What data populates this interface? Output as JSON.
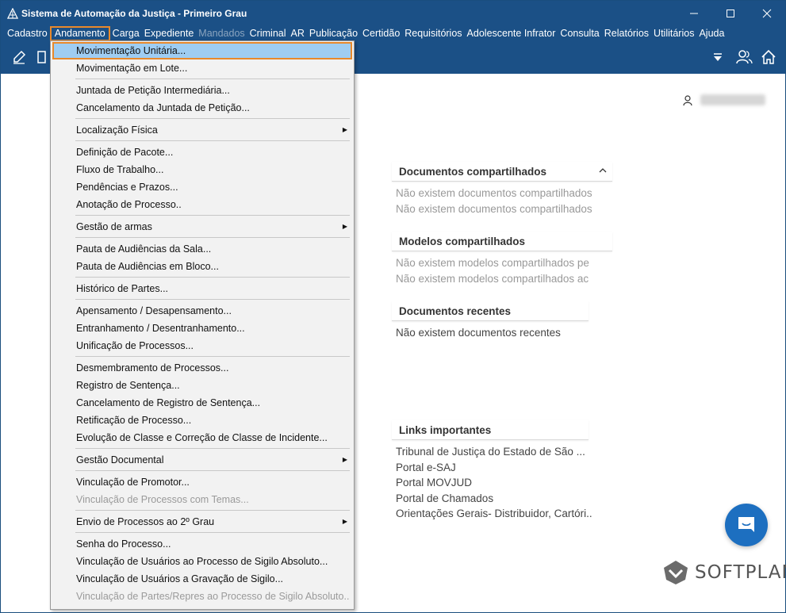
{
  "window": {
    "title": "Sistema de Automação da Justiça - Primeiro Grau"
  },
  "menubar": {
    "items": [
      {
        "label": "Cadastro",
        "state": "normal"
      },
      {
        "label": "Andamento",
        "state": "active"
      },
      {
        "label": "Carga",
        "state": "normal"
      },
      {
        "label": "Expediente",
        "state": "normal"
      },
      {
        "label": "Mandados",
        "state": "disabled"
      },
      {
        "label": "Criminal",
        "state": "normal"
      },
      {
        "label": "AR",
        "state": "normal"
      },
      {
        "label": "Publicação",
        "state": "normal"
      },
      {
        "label": "Certidão",
        "state": "normal"
      },
      {
        "label": "Requisitórios",
        "state": "normal"
      },
      {
        "label": "Adolescente Infrator",
        "state": "normal"
      },
      {
        "label": "Consulta",
        "state": "normal"
      },
      {
        "label": "Relatórios",
        "state": "normal"
      },
      {
        "label": "Utilitários",
        "state": "normal"
      },
      {
        "label": "Ajuda",
        "state": "normal"
      }
    ]
  },
  "dropdown": {
    "items": [
      {
        "label": "Movimentação Unitária...",
        "state": "highlight"
      },
      {
        "label": "Movimentação em Lote...",
        "state": "normal"
      },
      {
        "label": "Juntada de Petição Intermediária...",
        "state": "normal"
      },
      {
        "label": "Cancelamento da Juntada de Petição...",
        "state": "normal"
      },
      {
        "label": "Localização Física",
        "state": "normal",
        "submenu": true
      },
      {
        "label": "Definição de Pacote...",
        "state": "normal"
      },
      {
        "label": "Fluxo de Trabalho...",
        "state": "normal"
      },
      {
        "label": "Pendências e Prazos...",
        "state": "normal"
      },
      {
        "label": "Anotação de Processo..",
        "state": "normal"
      },
      {
        "label": "Gestão de armas",
        "state": "normal",
        "submenu": true
      },
      {
        "label": "Pauta de Audiências da Sala...",
        "state": "normal"
      },
      {
        "label": "Pauta de Audiências em Bloco...",
        "state": "normal"
      },
      {
        "label": "Histórico de Partes...",
        "state": "normal"
      },
      {
        "label": "Apensamento / Desapensamento...",
        "state": "normal"
      },
      {
        "label": "Entranhamento / Desentranhamento...",
        "state": "normal"
      },
      {
        "label": "Unificação de Processos...",
        "state": "normal"
      },
      {
        "label": "Desmembramento de Processos...",
        "state": "normal"
      },
      {
        "label": "Registro de Sentença...",
        "state": "normal"
      },
      {
        "label": "Cancelamento de Registro de Sentença...",
        "state": "normal"
      },
      {
        "label": "Retificação de Processo...",
        "state": "normal"
      },
      {
        "label": "Evolução de Classe e Correção de Classe de Incidente...",
        "state": "normal"
      },
      {
        "label": "Gestão Documental",
        "state": "normal",
        "submenu": true
      },
      {
        "label": "Vinculação de Promotor...",
        "state": "normal"
      },
      {
        "label": "Vinculação de Processos com Temas...",
        "state": "disabled"
      },
      {
        "label": "Envio de Processos ao 2º Grau",
        "state": "normal",
        "submenu": true
      },
      {
        "label": "Senha do Processo...",
        "state": "normal"
      },
      {
        "label": "Vinculação de Usuários ao Processo de Sigilo Absoluto...",
        "state": "normal"
      },
      {
        "label": "Vinculação de Usuários a Gravação de Sigilo...",
        "state": "normal"
      },
      {
        "label": "Vinculação de Partes/Repres ao Processo de Sigilo Absoluto..",
        "state": "disabled"
      }
    ]
  },
  "panels": {
    "shared_docs": {
      "title": "Documentos compartilhados",
      "lines": [
        "Não existem documentos compartilhados ...",
        "Não existem documentos compartilhados ..."
      ]
    },
    "shared_models": {
      "title": "Modelos compartilhados",
      "lines": [
        "Não existem modelos compartilhados pe",
        "Não existem modelos compartilhados ac"
      ]
    },
    "recent_docs": {
      "title": "Documentos recentes",
      "lines": [
        "Não existem documentos recentes"
      ]
    },
    "links": {
      "title": "Links importantes",
      "lines": [
        "Tribunal de Justiça do Estado de São ...",
        "Portal e-SAJ",
        "Portal MOVJUD",
        "Portal de Chamados",
        "Orientações Gerais- Distribuidor, Cartóri.."
      ]
    }
  },
  "brand": {
    "name": "SOFTPLAN"
  },
  "colors": {
    "titlebar": "#1b5086",
    "highlight": "#9fcdf2",
    "accent_border": "#e8892b",
    "chat": "#1d6fc0"
  }
}
